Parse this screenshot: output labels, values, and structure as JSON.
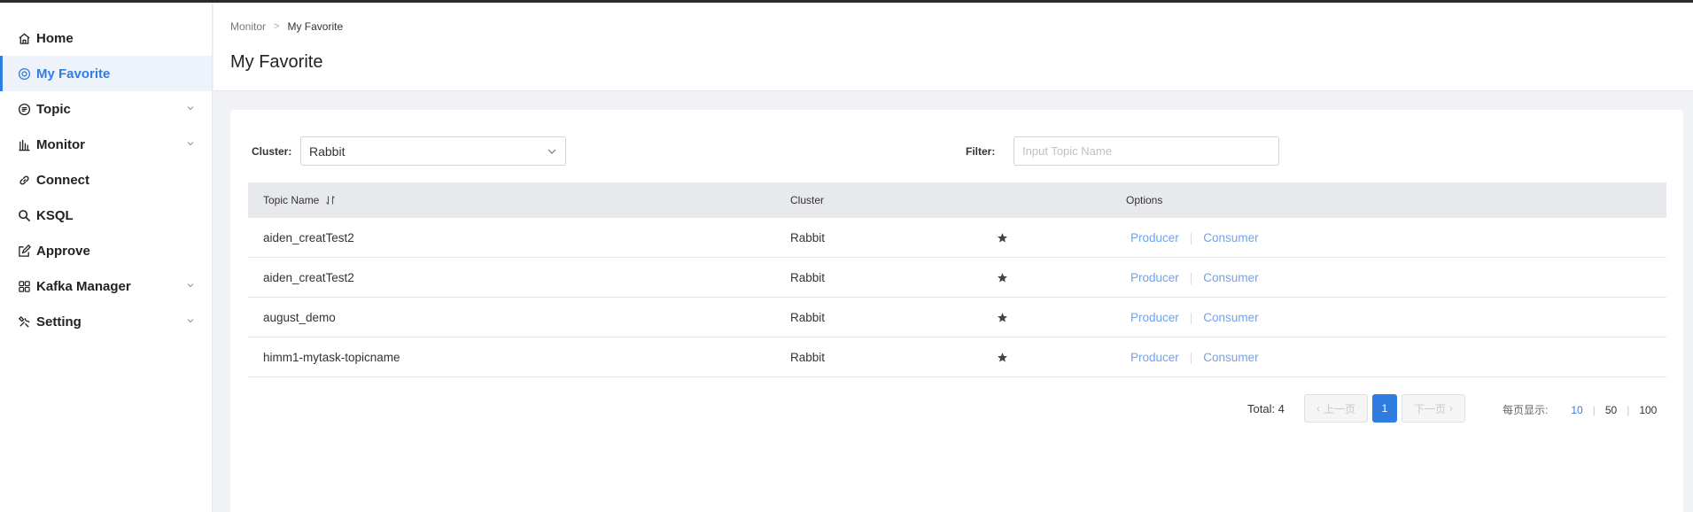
{
  "sidebar": {
    "items": [
      {
        "label": "Home",
        "icon": "home-icon"
      },
      {
        "label": "My Favorite",
        "icon": "favorite-icon",
        "active": true
      },
      {
        "label": "Topic",
        "icon": "topic-icon",
        "expandable": true
      },
      {
        "label": "Monitor",
        "icon": "bar-chart-icon",
        "expandable": true
      },
      {
        "label": "Connect",
        "icon": "link-icon"
      },
      {
        "label": "KSQL",
        "icon": "search-icon"
      },
      {
        "label": "Approve",
        "icon": "edit-icon"
      },
      {
        "label": "Kafka Manager",
        "icon": "grid-icon",
        "expandable": true
      },
      {
        "label": "Setting",
        "icon": "tools-icon",
        "expandable": true
      }
    ]
  },
  "header": {
    "breadcrumb": [
      "Monitor",
      "My Favorite"
    ],
    "title": "My Favorite"
  },
  "filters": {
    "cluster_label": "Cluster:",
    "cluster_value": "Rabbit",
    "filter_label": "Filter:",
    "filter_placeholder": "Input Topic Name",
    "filter_value": ""
  },
  "table": {
    "columns": [
      "Topic Name",
      "Cluster",
      "",
      "Options"
    ],
    "rows": [
      {
        "topic": "aiden_creatTest2",
        "cluster": "Rabbit",
        "favorite": true
      },
      {
        "topic": "aiden_creatTest2",
        "cluster": "Rabbit",
        "favorite": true
      },
      {
        "topic": "august_demo",
        "cluster": "Rabbit",
        "favorite": true
      },
      {
        "topic": "himm1-mytask-topicname",
        "cluster": "Rabbit",
        "favorite": true
      }
    ],
    "option_producer": "Producer",
    "option_consumer": "Consumer"
  },
  "pagination": {
    "total_text": "Total: 4",
    "prev_label": "上一页",
    "next_label": "下一页",
    "current_page": "1",
    "page_size_label": "每页显示:",
    "page_sizes": [
      "10",
      "50",
      "100"
    ],
    "selected_page_size": "10"
  },
  "colors": {
    "accent": "#2f7de1",
    "link": "#6fa3ea",
    "header_row": "#e8e9ec",
    "background": "#f0f2f5"
  }
}
